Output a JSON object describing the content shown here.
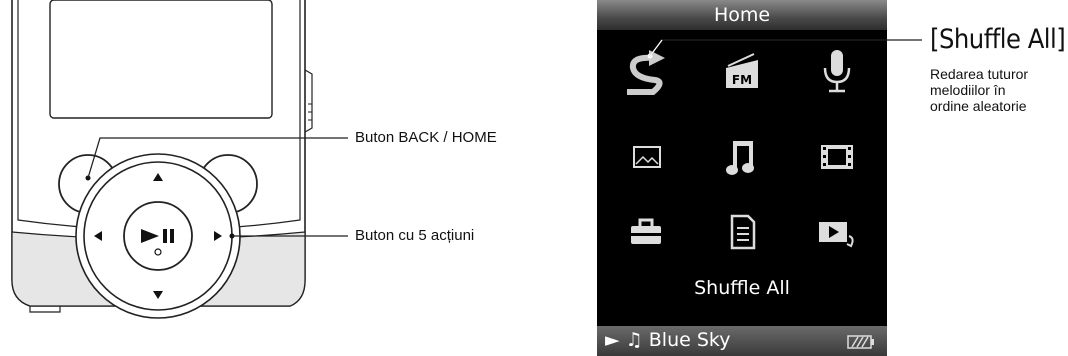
{
  "callouts": {
    "back_home": "Buton BACK / HOME",
    "five_way": "Buton cu 5 acțiuni"
  },
  "screen": {
    "title": "Home",
    "selected_item": "Shuffle All",
    "now_playing_prefix": "►",
    "note_icon": "♫",
    "now_playing": "Blue Sky",
    "icons": [
      "shuffle-icon",
      "fm-radio-icon",
      "microphone-icon",
      "photo-icon",
      "music-icon",
      "video-icon",
      "settings-toolbox-icon",
      "playlist-icon",
      "now-playing-icon"
    ]
  },
  "description": {
    "title": "[Shuffle All]",
    "lines": [
      "Redarea tuturor",
      "melodiilor în",
      "ordine aleatorie"
    ]
  },
  "device": {
    "play_pause_glyph": "►II"
  }
}
